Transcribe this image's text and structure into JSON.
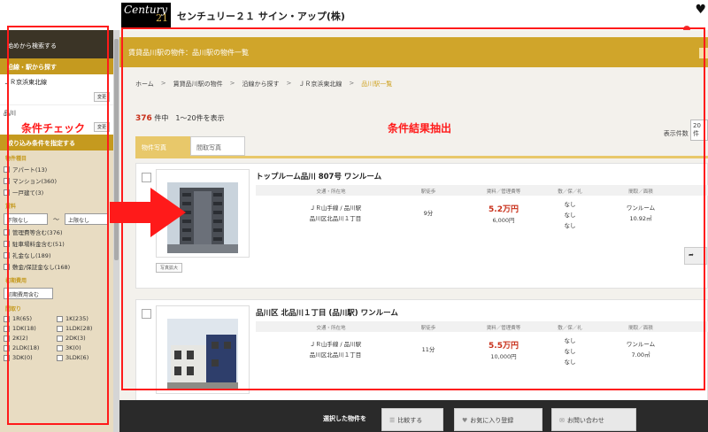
{
  "header": {
    "logo_text": "Century",
    "logo_num": "21",
    "brand": "センチュリー２１ サイン・アップ(株)"
  },
  "sidebar": {
    "search_from_start": "始めから検索する",
    "route_section": "沿線・駅から探す",
    "route_value": "ＪＲ京浜東北線",
    "station_value": "品川",
    "change_label": "変更",
    "narrow_section": "絞り込み条件を指定する",
    "type_group": "物件種目",
    "types": [
      "アパート(13)",
      "マンション(360)",
      "一戸建て(3)"
    ],
    "rent_group": "賃料",
    "rent_min": "下限なし",
    "rent_tilde": "〜",
    "rent_max": "上限なし",
    "rent_opts": [
      "管理費等含む(376)",
      "駐車場料金含む(51)",
      "礼金なし(189)",
      "敷金/保証金なし(168)"
    ],
    "cond_group": "初期費用",
    "cond_value": "初期費用含む",
    "layout_group": "間取り",
    "layouts": [
      "1R(65)",
      "1K(235)",
      "1DK(18)",
      "1LDK(28)",
      "2K(2)",
      "2DK(3)",
      "2LDK(18)",
      "3K(0)",
      "3DK(0)",
      "3LDK(6)"
    ]
  },
  "main": {
    "title": "賃貸品川駅の物件：品川駅の物件一覧",
    "breadcrumbs": [
      "ホーム",
      "賃貸品川駅の物件",
      "沿線から探す",
      "ＪＲ京浜東北線",
      "品川駅一覧"
    ],
    "count_num": "376",
    "count_suffix": "件中　1〜20件を表示",
    "display_label": "表示件数",
    "display_value": "20件",
    "tab_photo": "物件写真",
    "tab_layout": "間取写真",
    "columns": [
      "交通・所在地",
      "駅徒歩",
      "賃料／管理費等",
      "敷／保／礼",
      "間取／面積"
    ],
    "photo_tag": "写真拡大",
    "detail_label": "詳細",
    "listings": [
      {
        "name": "トップルーム品川 807号 ワンルーム",
        "line": "ＪＲ山手線 / 品川駅",
        "address": "品川区北品川１丁目",
        "walk": "9分",
        "rent": "5.2万円",
        "mgmt": "6,000円",
        "deposit": [
          "なし",
          "なし",
          "なし"
        ],
        "layout": "ワンルーム",
        "area": "10.92㎡"
      },
      {
        "name": "品川区 北品川１丁目 (品川駅) ワンルーム",
        "line": "ＪＲ山手線 / 品川駅",
        "address": "品川区北品川１丁目",
        "walk": "11分",
        "rent": "5.5万円",
        "mgmt": "10,000円",
        "deposit": [
          "なし",
          "なし",
          "なし"
        ],
        "layout": "ワンルーム",
        "area": "7.00㎡"
      }
    ]
  },
  "bottom_bar": {
    "selected_label": "選択した物件を",
    "compare": "比較する",
    "favorite": "お気に入り登録",
    "inquiry": "お問い合わせ"
  },
  "annotations": {
    "left_label": "条件チェック",
    "right_label": "条件結果抽出"
  },
  "colors": {
    "gold": "#d0a52a",
    "annotation_red": "#ff1a1a",
    "price_red": "#c8301a"
  }
}
